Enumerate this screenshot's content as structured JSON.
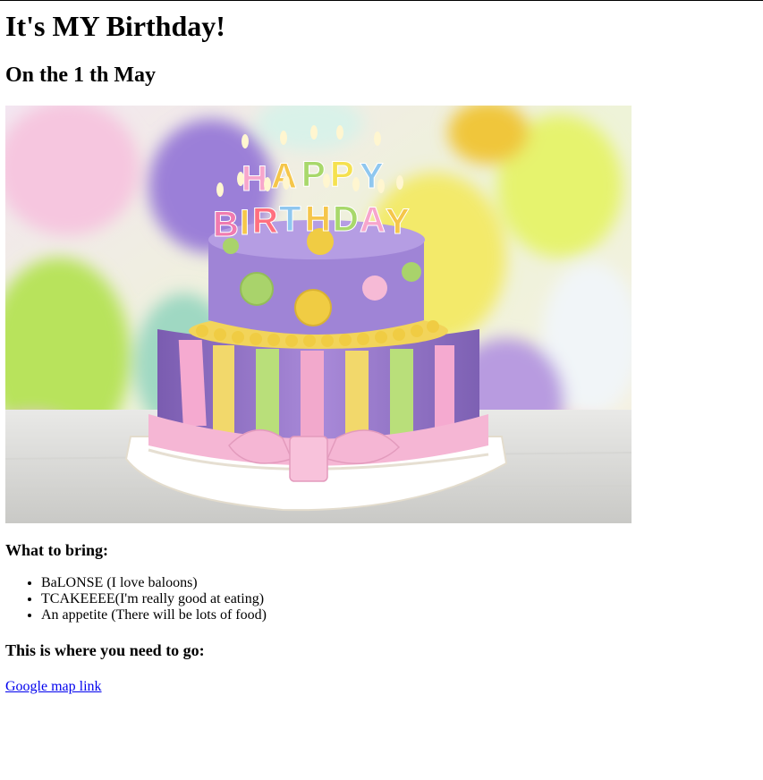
{
  "page": {
    "title": "It's MY Birthday!",
    "subtitle": "On the 1 th May"
  },
  "image": {
    "alt": "Birthday cake"
  },
  "bring": {
    "heading": "What to bring:",
    "items": [
      "BaLONSE (I love baloons)",
      "TCAKEEEE(I'm really good at eating)",
      "An appetite (There will be lots of food)"
    ]
  },
  "location": {
    "heading": "This is where you need to go:",
    "link_text": "Google map link"
  },
  "colors": {
    "link": "#0000ee"
  }
}
